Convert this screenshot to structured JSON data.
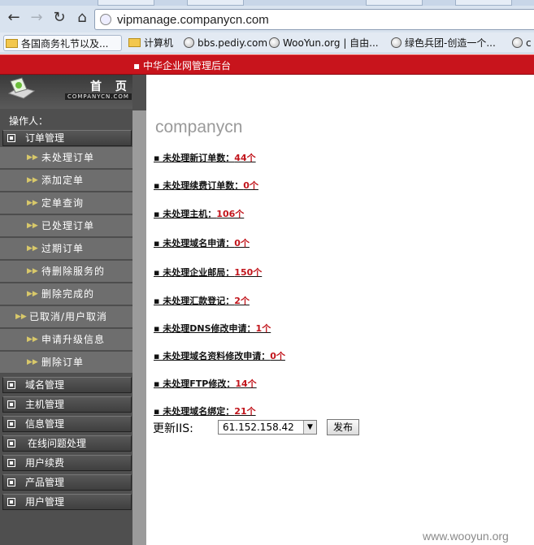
{
  "browser": {
    "url": "vipmanage.companycn.com",
    "bookmarks": [
      {
        "label": "各国商务礼节以及...",
        "icon": "folder-icon"
      },
      {
        "label": "计算机",
        "icon": "folder-icon"
      },
      {
        "label": "bbs.pediy.com",
        "icon": "globe-icon"
      },
      {
        "label": "WooYun.org | 自由...",
        "icon": "globe-icon"
      },
      {
        "label": "绿色兵团-创造一个...",
        "icon": "globe-icon"
      },
      {
        "label": "c",
        "icon": "globe-icon"
      }
    ]
  },
  "header": {
    "title": "▪ 中华企业网管理后台"
  },
  "sidebar": {
    "logo_home": "首 页",
    "logo_sub": "COMPANYCN.COM",
    "operator": "操作人：",
    "order_group": "订单管理",
    "order_items": [
      "未处理订单",
      "添加定单",
      "定单查询",
      "已处理订单",
      "过期订单",
      "待删除服务的",
      "删除完成的",
      "已取消/用户取消",
      "申请升级信息",
      "删除订单"
    ],
    "groups": [
      "域名管理",
      "主机管理",
      "信息管理",
      "在线问题处理",
      "用户续费",
      "产品管理",
      "用户管理"
    ]
  },
  "main": {
    "brand": "companycn",
    "stats": [
      {
        "label": "▪ 未处理新订单数：",
        "count": "44个"
      },
      {
        "label": "▪ 未处理续费订单数：",
        "count": "0个"
      },
      {
        "label": "▪ 未处理主机：",
        "count": "106个"
      },
      {
        "label": "▪ 未处理域名申请：",
        "count": "0个"
      },
      {
        "label": "▪ 未处理企业邮局：",
        "count": "150个"
      },
      {
        "label": "▪ 未处理汇款登记：",
        "count": "2个"
      },
      {
        "label": "▪ 未处理DNS修改申请：",
        "count": "1个"
      },
      {
        "label": "▪ 未处理域名资料修改申请：",
        "count": "0个"
      },
      {
        "label": "▪ 未处理FTP修改：",
        "count": "14个"
      },
      {
        "label": "▪ 未处理域名绑定：",
        "count": "21个"
      }
    ],
    "iis_label": "更新IIS:",
    "iis_value": "61.152.158.42",
    "publish_label": "发布"
  },
  "watermark": "www.wooyun.org",
  "colors": {
    "banner": "#c8141c",
    "count": "#c1141b",
    "sidebar": "#4f4f4f"
  }
}
